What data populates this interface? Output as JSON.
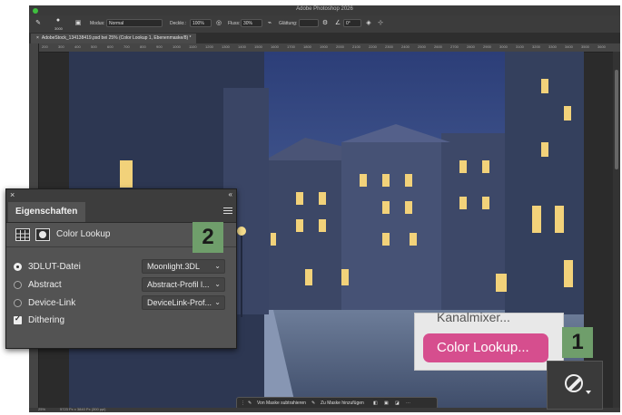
{
  "app": {
    "title": "Adobe Photoshop 2026"
  },
  "options_bar": {
    "brush_size": "3000",
    "mode_label": "Modus:",
    "mode_value": "Normal",
    "opacity_label": "Deckkr.:",
    "opacity_value": "100%",
    "flow_label": "Fluss:",
    "flow_value": "30%",
    "smoothing_label": "Glättung:",
    "angle_value": "0°"
  },
  "document": {
    "tab_label": "AdobeStock_134138419.psd bei 25% (Color Lookup 1, Ebenenmaske/8) *",
    "ruler_ticks": [
      "200",
      "300",
      "400",
      "500",
      "600",
      "700",
      "800",
      "900",
      "1000",
      "1100",
      "1200",
      "1300",
      "1400",
      "1500",
      "1600",
      "1700",
      "1800",
      "1900",
      "2000",
      "2100",
      "2200",
      "2300",
      "2400",
      "2500",
      "2600",
      "2700",
      "2800",
      "2900",
      "3000",
      "3100",
      "3200",
      "3300",
      "3400",
      "3500",
      "3600"
    ],
    "zoom": "25%",
    "doc_info": "5723 Px x 3840 Px (300 ppi)"
  },
  "taskbar": {
    "subtract_label": "Von Maske subtrahieren",
    "add_label": "Zu Maske hinzufügen"
  },
  "properties_panel": {
    "tab_label": "Eigenschaften",
    "header_title": "Color Lookup",
    "badge": "2",
    "rows": [
      {
        "label": "3DLUT-Datei",
        "value": "Moonlight.3DL",
        "selected": true
      },
      {
        "label": "Abstract",
        "value": "Abstract-Profil l...",
        "selected": false
      },
      {
        "label": "Device-Link",
        "value": "DeviceLink-Prof...",
        "selected": false
      }
    ],
    "dithering_label": "Dithering",
    "dithering_checked": true
  },
  "menu_popup": {
    "previous_item": "Kanalmixer...",
    "active_item": "Color Lookup...",
    "badge": "1",
    "accent": "#d64e8e"
  },
  "colors": {
    "badge_green": "#6f9e6b",
    "panel_bg": "#535353"
  }
}
